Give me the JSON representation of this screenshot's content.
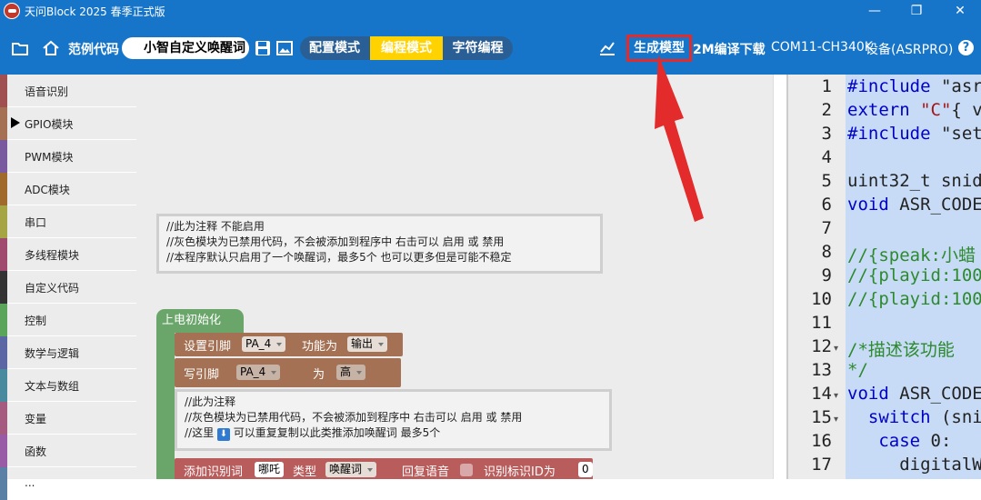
{
  "window": {
    "title": "天问Block 2025 春季正式版",
    "controls": [
      "—",
      "❐",
      "✕"
    ]
  },
  "toolbar": {
    "examples_label": "范例代码",
    "project_name": "小智自定义唤醒词",
    "modes": [
      {
        "label": "配置模式",
        "active": false
      },
      {
        "label": "编程模式",
        "active": true
      },
      {
        "label": "字符编程",
        "active": false
      }
    ],
    "generate_model": "生成模型",
    "compile_download": "2M编译下载",
    "port": "COM11-CH340K",
    "device": "设备(ASRPRO)",
    "help": "?"
  },
  "sidebar": {
    "categories": [
      {
        "label": "语音识别",
        "color": "#a05050",
        "selected": false
      },
      {
        "label": "GPIO模块",
        "color": "#a47154",
        "selected": true
      },
      {
        "label": "PWM模块",
        "color": "#7a5a9e",
        "selected": false
      },
      {
        "label": "ADC模块",
        "color": "#a06a2a",
        "selected": false
      },
      {
        "label": "串口",
        "color": "#a5a544",
        "selected": false
      },
      {
        "label": "多线程模块",
        "color": "#a04a70",
        "selected": false
      },
      {
        "label": "自定义代码",
        "color": "#333333",
        "selected": false
      },
      {
        "label": "控制",
        "color": "#5ba55b",
        "selected": false
      },
      {
        "label": "数学与逻辑",
        "color": "#5b67a5",
        "selected": false
      },
      {
        "label": "文本与数组",
        "color": "#4a8a9e",
        "selected": false
      },
      {
        "label": "变量",
        "color": "#a55b80",
        "selected": false
      },
      {
        "label": "函数",
        "color": "#995ba5",
        "selected": false
      },
      {
        "label": "...",
        "color": "#5b80a5",
        "selected": false
      }
    ]
  },
  "workspace": {
    "comment1": [
      "//此为注释 不能启用",
      "//灰色模块为已禁用代码，不会被添加到程序中 右击可以 启用 或 禁用",
      "//本程序默认只启用了一个唤醒词，最多5个 也可以更多但是可能不稳定"
    ],
    "setup_label": "上电初始化",
    "pin_mode": {
      "label": "设置引脚",
      "pin": "PA_4",
      "func_label": "功能为",
      "func": "输出"
    },
    "write_pin": {
      "label": "写引脚",
      "pin": "PA_4",
      "as": "为",
      "value": "高"
    },
    "comment2": [
      "//此为注释",
      "//灰色模块为已禁用代码，不会被添加到程序中 右击可以 启用 或 禁用",
      "//这里",
      "可以重复复制以此类推添加唤醒词 最多5个"
    ],
    "down_icon": "⬇",
    "add_word": {
      "label": "添加识别词",
      "word": "哪吒",
      "type_label": "类型",
      "type": "唤醒词",
      "reply_label": "回复语音",
      "id_label": "识别标识ID为",
      "id": "0"
    }
  },
  "code": {
    "lines": [
      {
        "n": "1",
        "fold": false,
        "parts": [
          [
            "kw",
            "#include"
          ],
          [
            "",
            " \"asr"
          ]
        ]
      },
      {
        "n": "2",
        "fold": false,
        "parts": [
          [
            "kw",
            "extern"
          ],
          [
            "",
            " "
          ],
          [
            "str",
            "\"C\""
          ],
          [
            "",
            "{ v"
          ]
        ]
      },
      {
        "n": "3",
        "fold": false,
        "parts": [
          [
            "kw",
            "#include"
          ],
          [
            "",
            " \"set"
          ]
        ]
      },
      {
        "n": "4",
        "fold": false,
        "parts": []
      },
      {
        "n": "5",
        "fold": false,
        "parts": [
          [
            "",
            "uint32_t snid"
          ]
        ]
      },
      {
        "n": "6",
        "fold": false,
        "parts": [
          [
            "kw",
            "void"
          ],
          [
            "",
            " ASR_CODE"
          ]
        ]
      },
      {
        "n": "7",
        "fold": false,
        "parts": []
      },
      {
        "n": "8",
        "fold": false,
        "parts": [
          [
            "cm",
            "//{speak:小蜡"
          ]
        ]
      },
      {
        "n": "9",
        "fold": false,
        "parts": [
          [
            "cm",
            "//{playid:100"
          ]
        ]
      },
      {
        "n": "10",
        "fold": false,
        "parts": [
          [
            "cm",
            "//{playid:100"
          ]
        ]
      },
      {
        "n": "11",
        "fold": false,
        "parts": []
      },
      {
        "n": "12",
        "fold": true,
        "parts": [
          [
            "cm",
            "/*描述该功能"
          ]
        ]
      },
      {
        "n": "13",
        "fold": false,
        "parts": [
          [
            "cm",
            "*/"
          ]
        ]
      },
      {
        "n": "14",
        "fold": true,
        "parts": [
          [
            "kw",
            "void"
          ],
          [
            "",
            " ASR_CODE"
          ]
        ]
      },
      {
        "n": "15",
        "fold": true,
        "parts": [
          [
            "",
            "  "
          ],
          [
            "kw",
            "switch"
          ],
          [
            "",
            " (sni"
          ]
        ]
      },
      {
        "n": "16",
        "fold": false,
        "parts": [
          [
            "",
            "   "
          ],
          [
            "kw",
            "case"
          ],
          [
            "",
            " 0:"
          ]
        ]
      },
      {
        "n": "17",
        "fold": false,
        "parts": [
          [
            "",
            "     digitalWr"
          ]
        ]
      }
    ]
  },
  "colors": {
    "accent": "#1675c9",
    "active_mode": "#ffd200",
    "highlight": "#e32b2b",
    "block_brown": "#a47154",
    "block_green": "#6aa56a",
    "code_bg": "#c7dbf7"
  }
}
